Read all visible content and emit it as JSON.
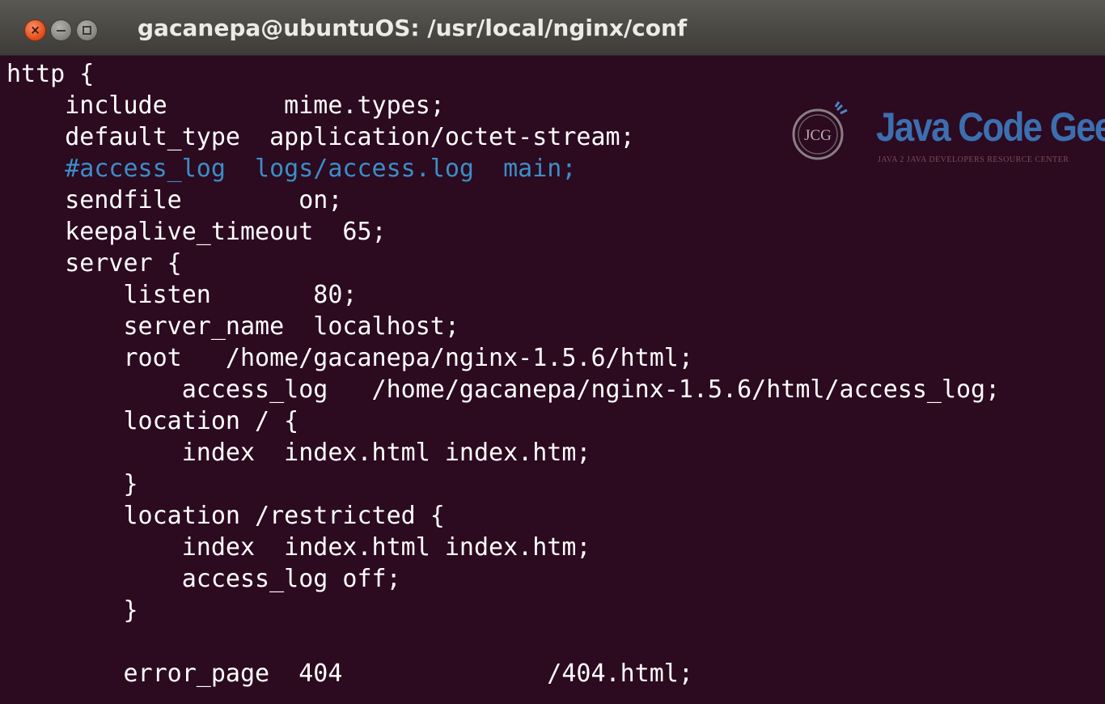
{
  "window": {
    "title": "gacanepa@ubuntuOS: /usr/local/nginx/conf",
    "close_glyph": "×"
  },
  "terminal": {
    "lines": [
      {
        "text": "http {",
        "comment": false
      },
      {
        "text": "    include        mime.types;",
        "comment": false
      },
      {
        "text": "    default_type  application/octet-stream;",
        "comment": false
      },
      {
        "text": "    #access_log  logs/access.log  main;",
        "comment": true
      },
      {
        "text": "    sendfile        on;",
        "comment": false
      },
      {
        "text": "    keepalive_timeout  65;",
        "comment": false
      },
      {
        "text": "    server {",
        "comment": false
      },
      {
        "text": "        listen       80;",
        "comment": false
      },
      {
        "text": "        server_name  localhost;",
        "comment": false
      },
      {
        "text": "        root   /home/gacanepa/nginx-1.5.6/html;",
        "comment": false
      },
      {
        "text": "            access_log   /home/gacanepa/nginx-1.5.6/html/access_log;",
        "comment": false
      },
      {
        "text": "        location / {",
        "comment": false
      },
      {
        "text": "            index  index.html index.htm;",
        "comment": false
      },
      {
        "text": "        }",
        "comment": false
      },
      {
        "text": "        location /restricted {",
        "comment": false
      },
      {
        "text": "            index  index.html index.htm;",
        "comment": false
      },
      {
        "text": "            access_log off;",
        "comment": false
      },
      {
        "text": "        }",
        "comment": false
      },
      {
        "text": "",
        "comment": false
      },
      {
        "text": "        error_page  404              /404.html;",
        "comment": false
      }
    ]
  },
  "watermark": {
    "monogram": "JCG",
    "title": "Java Code Geeks",
    "subtitle": "JAVA 2 JAVA DEVELOPERS RESOURCE CENTER"
  },
  "colors": {
    "background": "#2c0a1f",
    "text": "#ffffff",
    "comment": "#3b8ec7",
    "titlebar": "#3d3c38",
    "close_button": "#e4531c"
  }
}
